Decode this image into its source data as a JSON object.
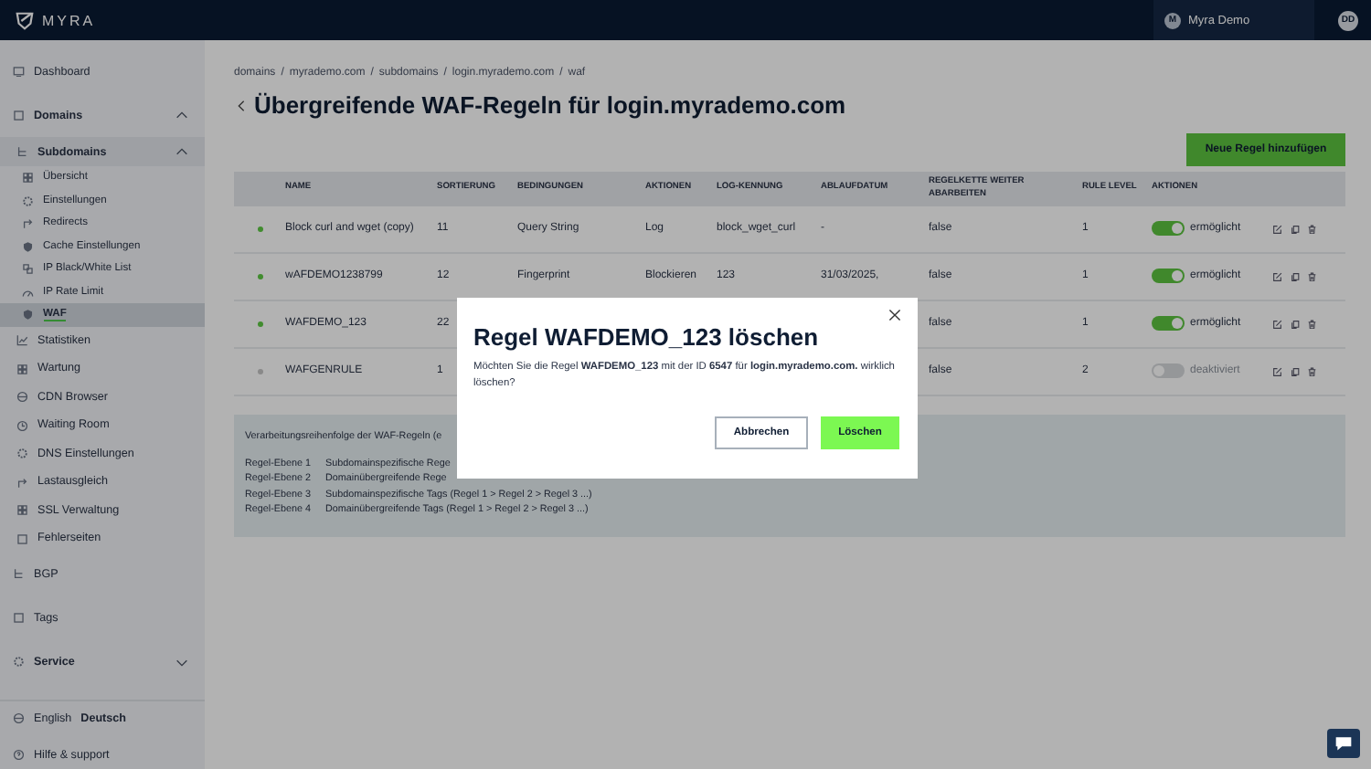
{
  "topbar": {
    "logo": "MYRA",
    "user": {
      "initial": "M",
      "name": "Myra Demo"
    },
    "account_badge": "DD"
  },
  "sidebar": {
    "items": [
      {
        "label": "Dashboard",
        "selected": false
      },
      {
        "label": "Domains",
        "selected": false,
        "expanded": true,
        "children": [
          {
            "label": "Subdomains",
            "selected": false,
            "expanded": true,
            "children": [
              {
                "label": "Übersicht",
                "selected": false
              },
              {
                "label": "Einstellungen",
                "selected": false
              },
              {
                "label": "Redirects",
                "selected": false
              },
              {
                "label": "Cache Einstellungen",
                "selected": false
              },
              {
                "label": "IP Black/White List",
                "selected": false
              },
              {
                "label": "IP Rate Limit",
                "selected": false
              },
              {
                "label": "WAF",
                "selected": true
              }
            ]
          },
          {
            "label": "Statistiken",
            "selected": false
          },
          {
            "label": "Wartung",
            "selected": false
          },
          {
            "label": "CDN Browser",
            "selected": false
          },
          {
            "label": "Waiting Room",
            "selected": false
          },
          {
            "label": "DNS Einstellungen",
            "selected": false
          },
          {
            "label": "Lastausgleich",
            "selected": false
          },
          {
            "label": "SSL Verwaltung",
            "selected": false
          },
          {
            "label": "Fehlerseiten",
            "selected": false
          }
        ]
      },
      {
        "label": "BGP",
        "selected": false
      },
      {
        "label": "Tags",
        "selected": false
      },
      {
        "label": "Service",
        "selected": false,
        "expanded": false
      }
    ],
    "languages": [
      {
        "label": "English",
        "selected": false
      },
      {
        "label": "Deutsch",
        "selected": true
      }
    ],
    "help": "Hilfe & support"
  },
  "breadcrumb": {
    "separator": "/",
    "items": [
      "domains",
      "myrademo.com",
      "subdomains",
      "login.myrademo.com",
      "waf"
    ]
  },
  "page_title": "Übergreifende WAF-Regeln für login.myrademo.com",
  "add_button": "Neue Regel hinzufügen",
  "table": {
    "columns": [
      "NAME",
      "SORTIERUNG",
      "BEDINGUNGEN",
      "AKTIONEN",
      "LOG-KENNUNG",
      "ABLAUFDATUM",
      "REGELKETTE WEITER ABARBEITEN",
      "RULE LEVEL",
      "AKTIONEN"
    ],
    "rows": [
      {
        "name": "Block curl and wget (copy)",
        "sort": "11",
        "condition": "Query String",
        "action": "Log",
        "log_id": "block_wget_curl",
        "expiry": "-",
        "chain": "false",
        "level": "1",
        "enabled": true,
        "status": "ermöglicht"
      },
      {
        "name": "wAFDEMO1238799",
        "sort": "12",
        "condition": "Fingerprint",
        "action": "Blockieren",
        "log_id": "123",
        "expiry": "31/03/2025,",
        "chain": "false",
        "level": "1",
        "enabled": true,
        "status": "ermöglicht"
      },
      {
        "name": "WAFDEMO_123",
        "sort": "22",
        "chain": "false",
        "level": "1",
        "enabled": true,
        "status": "ermöglicht"
      },
      {
        "name": "WAFGENRULE",
        "sort": "1",
        "chain": "false",
        "level": "2",
        "enabled": false,
        "status": "deaktiviert"
      }
    ]
  },
  "legend": {
    "heading": "Verarbeitungsreihenfolge der WAF-Regeln (e",
    "lines": [
      {
        "level": "Regel-Ebene 1",
        "text": "Subdomainspezifische Rege"
      },
      {
        "level": "Regel-Ebene 2",
        "text": "Domainübergreifende Rege"
      },
      {
        "level": "Regel-Ebene 3",
        "text": "Subdomainspezifische Tags (Regel 1 > Regel 2 > Regel 3 ...)"
      },
      {
        "level": "Regel-Ebene 4",
        "text": "Domainübergreifende Tags (Regel 1 > Regel 2 > Regel 3 ...)"
      }
    ]
  },
  "dialog": {
    "title": "Regel WAFDEMO_123 löschen",
    "message": "Möchten Sie die Regel **WAFDEMO_123** mit der ID **6547** für **login.myrademo.com.** wirklich löschen?",
    "cancel": "Abbrechen",
    "confirm": "Löschen"
  }
}
